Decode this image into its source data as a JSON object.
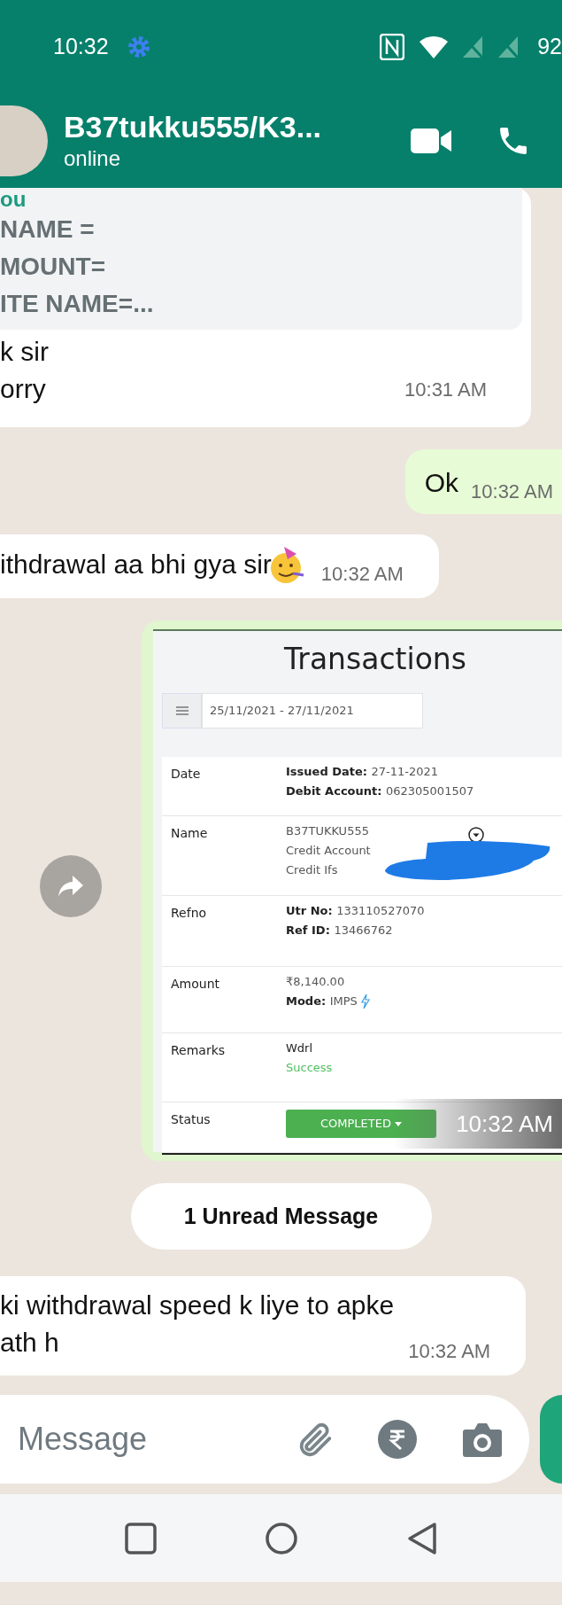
{
  "status_bar": {
    "time": "10:32",
    "battery": "92"
  },
  "header": {
    "title": "B37tukku555/K3...",
    "subtitle": "online"
  },
  "messages": [
    {
      "kind": "quoted",
      "quote": {
        "author": "ou",
        "lines": [
          "NAME =",
          "MOUNT=",
          "ITE NAME=..."
        ]
      },
      "lines": [
        "k sir",
        "orry"
      ],
      "time": "10:31 AM"
    },
    {
      "kind": "outgoing",
      "lines": [
        "Ok"
      ],
      "time": "10:32 AM"
    },
    {
      "kind": "incoming",
      "lines": [
        "ithdrawal aa bhi gya sir"
      ],
      "emoji": true,
      "time": "10:32 AM"
    },
    {
      "kind": "image",
      "time": "10:32 AM",
      "transaction": {
        "title": "Transactions",
        "date_range": "25/11/2021 - 27/11/2021",
        "rows": [
          {
            "label": "Date",
            "lines": [
              {
                "key": "Issued Date:",
                "value": "27-11-2021"
              },
              {
                "key": "Debit Account:",
                "value": "062305001507"
              }
            ]
          },
          {
            "label": "Name",
            "dropdown": true,
            "redacted": true,
            "lines": [
              {
                "value": "B37TUKKU555"
              },
              {
                "value": "Credit Account"
              },
              {
                "value": "Credit Ifs"
              }
            ]
          },
          {
            "label": "Refno",
            "lines": [
              {
                "key": "Utr No:",
                "value": "133110527070"
              },
              {
                "key": "Ref ID:",
                "value": "13466762"
              }
            ]
          },
          {
            "label": "Amount",
            "lines": [
              {
                "value": "₹8,140.00"
              },
              {
                "key": "Mode:",
                "value": "IMPS",
                "bolt": true
              }
            ]
          },
          {
            "label": "Remarks",
            "lines": [
              {
                "value": "Wdrl",
                "color": "#222222"
              },
              {
                "value": "Success",
                "color": "#4fbf5f"
              }
            ]
          },
          {
            "label": "Status",
            "badge": "COMPLETED"
          }
        ]
      }
    },
    {
      "kind": "divider",
      "label": "1 Unread Message"
    },
    {
      "kind": "incoming",
      "lines": [
        "ki withdrawal speed k liye to apke",
        "ath h"
      ],
      "emoji": false,
      "time": "10:32 AM"
    }
  ],
  "composer": {
    "placeholder": "Message"
  }
}
